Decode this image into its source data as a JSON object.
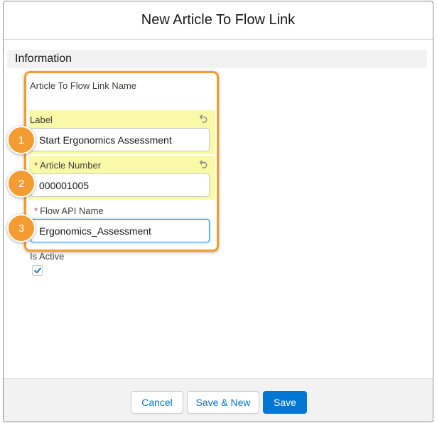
{
  "modal": {
    "title": "New Article To Flow Link",
    "section_title": "Information"
  },
  "fields": {
    "name": {
      "label": "Article To Flow Link Name"
    },
    "label": {
      "label": "Label",
      "value": "Start Ergonomics Assessment"
    },
    "article_number": {
      "label": "Article Number",
      "required_marker": "*",
      "value": "000001005"
    },
    "flow_api_name": {
      "label": "Flow API Name",
      "required_marker": "*",
      "value": "Ergonomics_Assessment"
    },
    "is_active": {
      "label": "Is Active",
      "checked": true
    }
  },
  "callouts": [
    "1",
    "2",
    "3"
  ],
  "footer": {
    "cancel_label": "Cancel",
    "save_new_label": "Save & New",
    "save_label": "Save"
  },
  "colors": {
    "highlight": "#f9faa8",
    "callout": "#f39c32",
    "brand": "#0176d3",
    "required": "#c23934"
  },
  "icons": [
    "undo-icon",
    "checkmark-icon"
  ]
}
